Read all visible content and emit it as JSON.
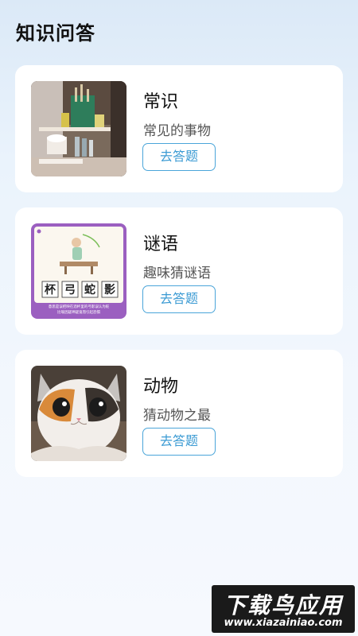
{
  "header": {
    "title": "知识问答"
  },
  "categories": [
    {
      "title": "常识",
      "subtitle": "常见的事物",
      "button_label": "去答题",
      "image": "shelf-photo"
    },
    {
      "title": "谜语",
      "subtitle": "趣味猜谜语",
      "button_label": "去答题",
      "image": "riddle-illustration",
      "image_text": {
        "idiom": [
          "杯",
          "弓",
          "蛇",
          "影"
        ],
        "caption_line1": "意思是误把映在酒杯里的弓影误认为蛇",
        "caption_line2": "比喻因疑神疑鬼而引起恐惧"
      }
    },
    {
      "title": "动物",
      "subtitle": "猜动物之最",
      "button_label": "去答题",
      "image": "cat-photo"
    }
  ],
  "watermark": {
    "main": "下载鸟应用",
    "url": "www.xiazainiao.com"
  }
}
